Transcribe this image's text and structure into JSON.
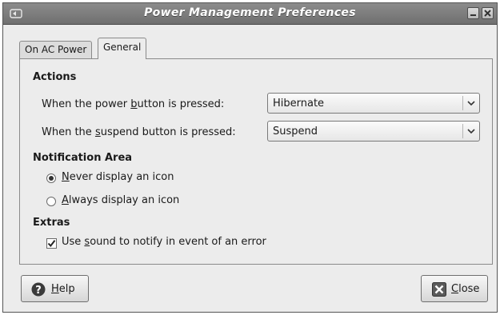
{
  "window": {
    "title": "Power Management Preferences",
    "icon": "power-manager-icon"
  },
  "tabs": [
    {
      "label": "On AC Power",
      "active": false
    },
    {
      "label": "General",
      "active": true
    }
  ],
  "actions": {
    "heading": "Actions",
    "power_button": {
      "label_pre": "When the power ",
      "label_mnemonic": "b",
      "label_post": "utton is pressed:",
      "value": "Hibernate"
    },
    "suspend_button": {
      "label_pre": "When the ",
      "label_mnemonic": "s",
      "label_post": "uspend button is pressed:",
      "value": "Suspend"
    }
  },
  "notification_area": {
    "heading": "Notification Area",
    "options": [
      {
        "mnemonic": "N",
        "rest": "ever display an icon",
        "selected": true
      },
      {
        "mnemonic": "A",
        "rest": "lways display an icon",
        "selected": false
      }
    ]
  },
  "extras": {
    "heading": "Extras",
    "sound": {
      "pre": "Use ",
      "mnemonic": "s",
      "post": "ound to notify in event of an error",
      "checked": true
    }
  },
  "buttons": {
    "help": {
      "mnemonic": "H",
      "rest": "elp",
      "icon": "help-icon"
    },
    "close": {
      "mnemonic": "C",
      "rest": "lose",
      "icon": "close-icon"
    }
  }
}
